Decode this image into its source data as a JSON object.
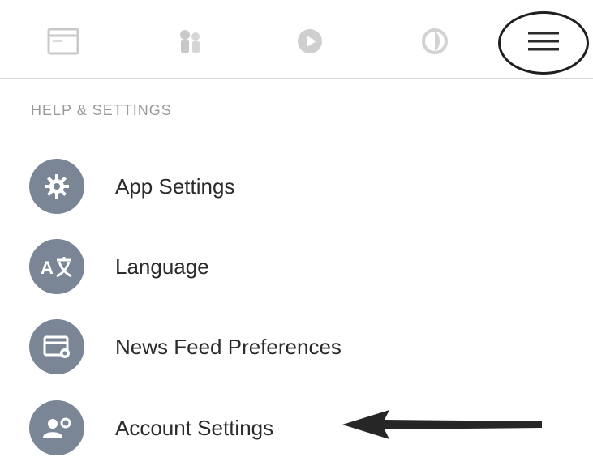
{
  "tabs": [
    {
      "icon": "news-feed-icon"
    },
    {
      "icon": "friends-icon"
    },
    {
      "icon": "watch-icon"
    },
    {
      "icon": "notifications-globe-icon"
    },
    {
      "icon": "hamburger-menu-icon"
    }
  ],
  "section": {
    "header": "HELP & SETTINGS"
  },
  "items": [
    {
      "label": "App Settings",
      "icon": "gear-icon"
    },
    {
      "label": "Language",
      "icon": "translate-icon"
    },
    {
      "label": "News Feed Preferences",
      "icon": "news-feed-preferences-icon"
    },
    {
      "label": "Account Settings",
      "icon": "account-settings-icon"
    }
  ],
  "colors": {
    "icon_circle": "#7a8596",
    "header_text": "#9a9a9a",
    "label_text": "#2b2b2b",
    "annotation": "#1f1f1f"
  }
}
